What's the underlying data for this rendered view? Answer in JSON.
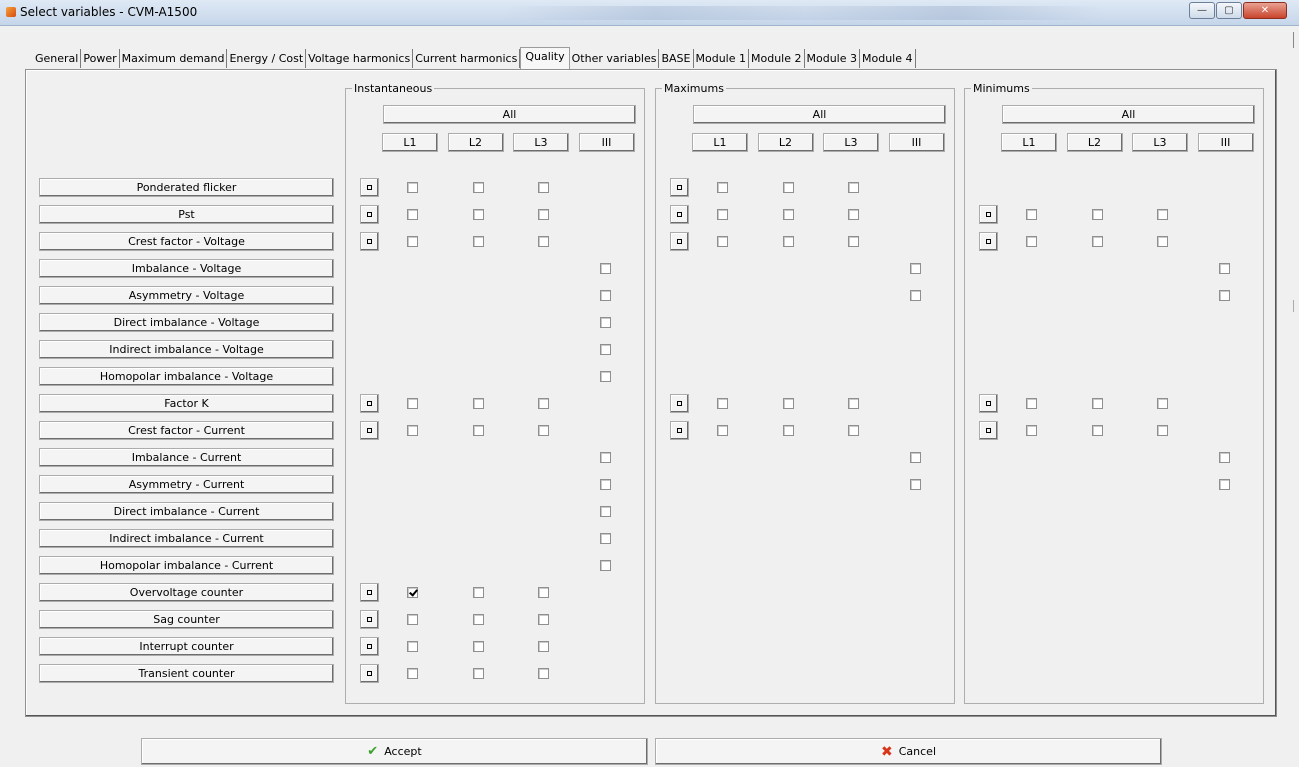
{
  "window": {
    "title": "Select  variables - CVM-A1500",
    "icon": "app-icon"
  },
  "tabs": [
    {
      "label": "General"
    },
    {
      "label": "Power"
    },
    {
      "label": "Maximum demand"
    },
    {
      "label": "Energy / Cost"
    },
    {
      "label": "Voltage harmonics"
    },
    {
      "label": "Current harmonics"
    },
    {
      "label": "Quality",
      "active": true
    },
    {
      "label": "Other variables"
    },
    {
      "label": "BASE"
    },
    {
      "label": "Module 1"
    },
    {
      "label": "Module 2"
    },
    {
      "label": "Module 3"
    },
    {
      "label": "Module 4"
    }
  ],
  "groups": [
    {
      "key": "instantaneous",
      "title": "Instantaneous",
      "all_label": "All",
      "line_labels": [
        "L1",
        "L2",
        "L3",
        "III"
      ]
    },
    {
      "key": "maximums",
      "title": "Maximums",
      "all_label": "All",
      "line_labels": [
        "L1",
        "L2",
        "L3",
        "III"
      ]
    },
    {
      "key": "minimums",
      "title": "Minimums",
      "all_label": "All",
      "line_labels": [
        "L1",
        "L2",
        "L3",
        "III"
      ]
    }
  ],
  "rows": [
    {
      "label": "Ponderated flicker",
      "inst": "phase",
      "max": "phase",
      "min": "none"
    },
    {
      "label": "Pst",
      "inst": "phase",
      "max": "phase",
      "min": "phase"
    },
    {
      "label": "Crest factor - Voltage",
      "inst": "phase",
      "max": "phase",
      "min": "phase"
    },
    {
      "label": "Imbalance - Voltage",
      "inst": "total",
      "max": "total",
      "min": "total"
    },
    {
      "label": "Asymmetry - Voltage",
      "inst": "total",
      "max": "total",
      "min": "total"
    },
    {
      "label": "Direct imbalance - Voltage",
      "inst": "total",
      "max": "none",
      "min": "none"
    },
    {
      "label": "Indirect imbalance - Voltage",
      "inst": "total",
      "max": "none",
      "min": "none"
    },
    {
      "label": "Homopolar imbalance - Voltage",
      "inst": "total",
      "max": "none",
      "min": "none"
    },
    {
      "label": "Factor K",
      "inst": "phase",
      "max": "phase",
      "min": "phase"
    },
    {
      "label": "Crest factor - Current",
      "inst": "phase",
      "max": "phase",
      "min": "phase"
    },
    {
      "label": "Imbalance - Current",
      "inst": "total",
      "max": "total",
      "min": "total"
    },
    {
      "label": "Asymmetry - Current",
      "inst": "total",
      "max": "total",
      "min": "total"
    },
    {
      "label": "Direct imbalance - Current",
      "inst": "total",
      "max": "none",
      "min": "none"
    },
    {
      "label": "Indirect imbalance - Current",
      "inst": "total",
      "max": "none",
      "min": "none"
    },
    {
      "label": "Homopolar imbalance - Current",
      "inst": "total",
      "max": "none",
      "min": "none"
    },
    {
      "label": "Overvoltage counter",
      "inst": "phase",
      "max": "none",
      "min": "none",
      "checked_inst": [
        "L1"
      ]
    },
    {
      "label": "Sag counter",
      "inst": "phase",
      "max": "none",
      "min": "none"
    },
    {
      "label": "Interrupt counter",
      "inst": "phase",
      "max": "none",
      "min": "none"
    },
    {
      "label": "Transient counter",
      "inst": "phase",
      "max": "none",
      "min": "none"
    }
  ],
  "footer": {
    "accept_label": "Accept",
    "accept_icon": "check-icon",
    "cancel_label": "Cancel",
    "cancel_icon": "x-icon"
  }
}
